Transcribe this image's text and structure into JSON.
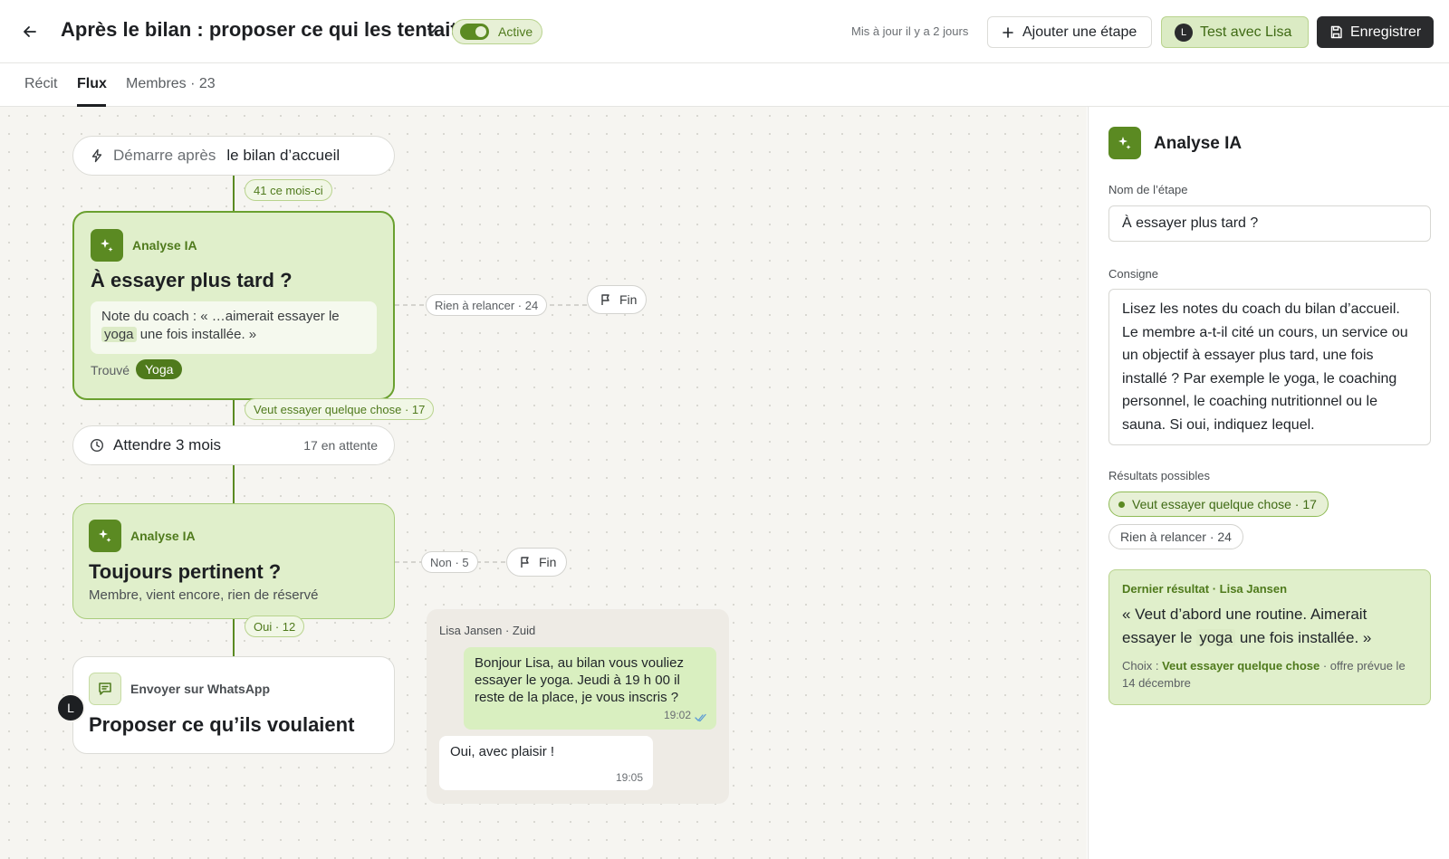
{
  "header": {
    "title": "Après le bilan : proposer ce qui les tentait",
    "status_label": "Active",
    "updated": "Mis à jour il y a 2 jours",
    "add_step_label": "Ajouter une étape",
    "test_label": "Test avec Lisa",
    "test_avatar": "L",
    "save_label": "Enregistrer"
  },
  "tabs": [
    {
      "label": "Récit"
    },
    {
      "label": "Flux"
    },
    {
      "label": "Membres · 23"
    }
  ],
  "flow": {
    "start": {
      "label": "Démarre après",
      "value": "le bilan d’accueil"
    },
    "start_count": "41 ce mois-ci",
    "ai1": {
      "tag": "Analyse IA",
      "title": "À essayer plus tard ?",
      "note_prefix": "Note du coach : « …aimerait essayer le",
      "note_highlight": "yoga",
      "note_suffix": "une fois installée. »",
      "found_label": "Trouvé",
      "found_tag": "Yoga",
      "branch_none": "Rien à relancer · 24",
      "branch_yes": "Veut essayer quelque chose · 17"
    },
    "fin_label": "Fin",
    "wait": {
      "label": "Attendre 3 mois",
      "count": "17 en attente"
    },
    "ai2": {
      "tag": "Analyse IA",
      "title": "Toujours pertinent ?",
      "subtitle": "Membre, vient encore, rien de réservé",
      "branch_no": "Non · 5",
      "branch_yes": "Oui · 12"
    },
    "whatsapp": {
      "tag": "Envoyer sur WhatsApp",
      "title": "Proposer ce qu’ils voulaient",
      "avatar": "L"
    }
  },
  "chat": {
    "header": "Lisa Jansen · Zuid",
    "outgoing": "Bonjour Lisa, au bilan vous vouliez essayer le yoga. Jeudi à 19 h 00 il reste de la place, je vous inscris ?",
    "outgoing_time": "19:02",
    "incoming": "Oui, avec plaisir !",
    "incoming_time": "19:05"
  },
  "panel": {
    "title": "Analyse IA",
    "name_label": "Nom de l’étape",
    "name_value": "À essayer plus tard ?",
    "prompt_label": "Consigne",
    "prompt_value": "Lisez les notes du coach du bilan d’accueil. Le membre a-t-il cité un cours, un service ou un objectif à essayer plus tard, une fois installé ? Par exemple le yoga, le coaching personnel, le coaching nutritionnel ou le sauna. Si oui, indiquez lequel.",
    "results_label": "Résultats possibles",
    "result_1": "Veut essayer quelque chose · 17",
    "result_2": "Rien à relancer · 24",
    "last_head": "Dernier résultat · Lisa Jansen",
    "last_quote_prefix": "« Veut d’abord une routine. Aimerait essayer le",
    "last_quote_highlight": "yoga",
    "last_quote_suffix": "une fois installée. »",
    "last_choice_prefix": "Choix :",
    "last_choice_value": "Veut essayer quelque chose",
    "last_choice_suffix": "· offre prévue le 14 décembre"
  },
  "colors": {
    "accent_green": "#5b8a22",
    "light_green": "#e0efcb",
    "dark_button": "#2a2b2d"
  }
}
